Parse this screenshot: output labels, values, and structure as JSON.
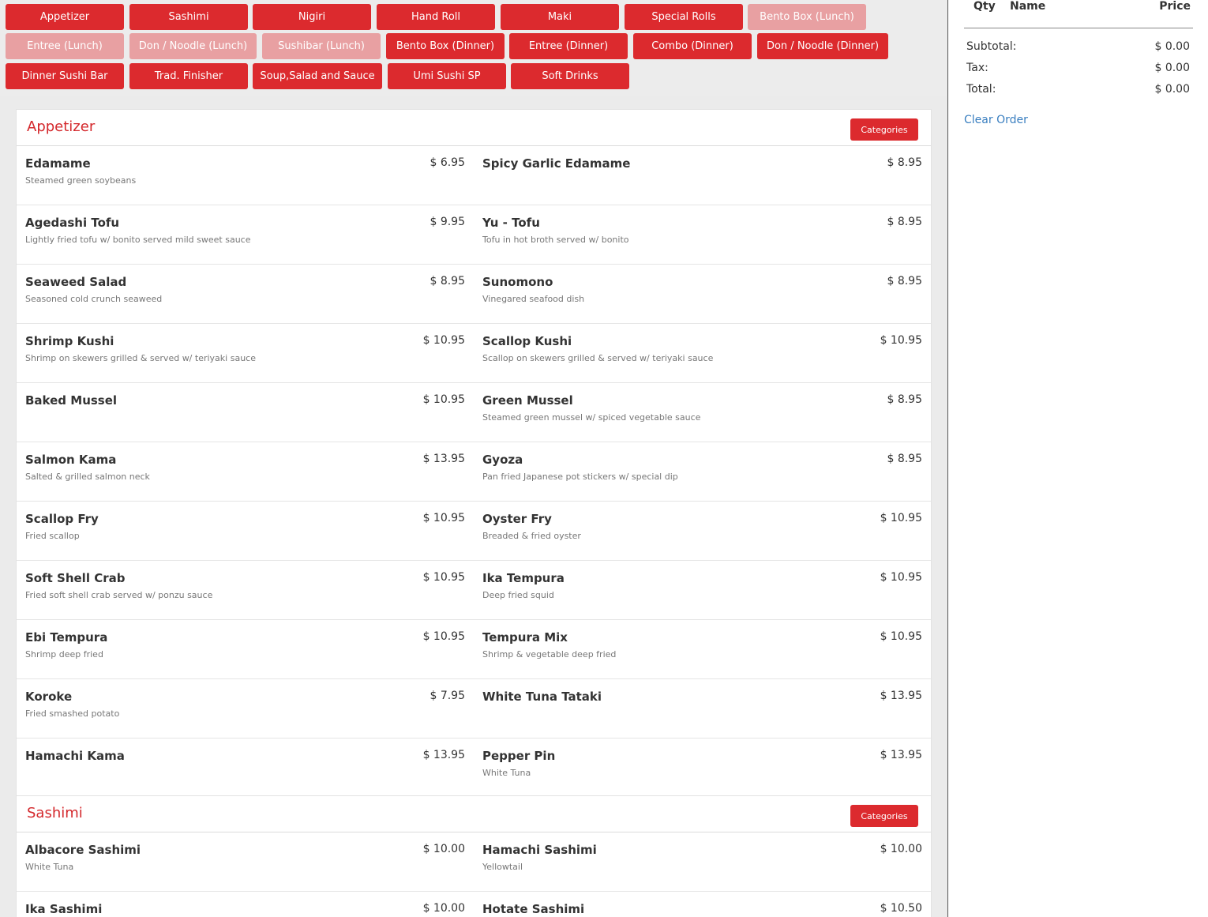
{
  "categories": [
    {
      "label": "Appetizer",
      "active": true
    },
    {
      "label": "Sashimi",
      "active": true
    },
    {
      "label": "Nigiri",
      "active": true
    },
    {
      "label": "Hand Roll",
      "active": true
    },
    {
      "label": "Maki",
      "active": true
    },
    {
      "label": "Special Rolls",
      "active": true
    },
    {
      "label": "Bento Box (Lunch)",
      "active": false
    },
    {
      "label": "Entree (Lunch)",
      "active": false
    },
    {
      "label": "Don / Noodle (Lunch)",
      "active": false
    },
    {
      "label": "Sushibar (Lunch)",
      "active": false
    },
    {
      "label": "Bento Box (Dinner)",
      "active": true
    },
    {
      "label": "Entree (Dinner)",
      "active": true
    },
    {
      "label": "Combo (Dinner)",
      "active": true
    },
    {
      "label": "Don / Noodle (Dinner)",
      "active": true
    },
    {
      "label": "Dinner Sushi Bar",
      "active": true
    },
    {
      "label": "Trad. Finisher",
      "active": true
    },
    {
      "label": "Soup,Salad and Sauce",
      "active": true
    },
    {
      "label": "Umi Sushi SP",
      "active": true
    },
    {
      "label": "Soft Drinks",
      "active": true
    }
  ],
  "colors": {
    "accent": "#dc2a2e",
    "disabled": "#e8a0a2",
    "link": "#3a7fc0"
  },
  "sections": [
    {
      "title": "Appetizer",
      "categories_button": "Categories",
      "items": [
        {
          "name": "Edamame",
          "price": "$ 6.95",
          "desc": "Steamed green soybeans"
        },
        {
          "name": "Spicy Garlic Edamame",
          "price": "$ 8.95",
          "desc": ""
        },
        {
          "name": "Agedashi Tofu",
          "price": "$ 9.95",
          "desc": "Lightly fried tofu w/ bonito served mild sweet sauce"
        },
        {
          "name": "Yu - Tofu",
          "price": "$ 8.95",
          "desc": "Tofu in hot broth served w/ bonito"
        },
        {
          "name": "Seaweed Salad",
          "price": "$ 8.95",
          "desc": "Seasoned cold crunch seaweed"
        },
        {
          "name": "Sunomono",
          "price": "$ 8.95",
          "desc": "Vinegared seafood dish"
        },
        {
          "name": "Shrimp Kushi",
          "price": "$ 10.95",
          "desc": "Shrimp on skewers grilled & served w/ teriyaki sauce"
        },
        {
          "name": "Scallop Kushi",
          "price": "$ 10.95",
          "desc": "Scallop on skewers grilled & served w/ teriyaki sauce"
        },
        {
          "name": "Baked Mussel",
          "price": "$ 10.95",
          "desc": ""
        },
        {
          "name": "Green Mussel",
          "price": "$ 8.95",
          "desc": "Steamed green mussel w/ spiced vegetable sauce"
        },
        {
          "name": "Salmon Kama",
          "price": "$ 13.95",
          "desc": "Salted & grilled salmon neck"
        },
        {
          "name": "Gyoza",
          "price": "$ 8.95",
          "desc": "Pan fried Japanese pot stickers w/ special dip"
        },
        {
          "name": "Scallop Fry",
          "price": "$ 10.95",
          "desc": "Fried scallop"
        },
        {
          "name": "Oyster Fry",
          "price": "$ 10.95",
          "desc": "Breaded & fried oyster"
        },
        {
          "name": "Soft Shell Crab",
          "price": "$ 10.95",
          "desc": "Fried soft shell crab served w/ ponzu sauce"
        },
        {
          "name": "Ika Tempura",
          "price": "$ 10.95",
          "desc": "Deep fried squid"
        },
        {
          "name": "Ebi Tempura",
          "price": "$ 10.95",
          "desc": "Shrimp deep fried"
        },
        {
          "name": "Tempura Mix",
          "price": "$ 10.95",
          "desc": "Shrimp & vegetable deep fried"
        },
        {
          "name": "Koroke",
          "price": "$ 7.95",
          "desc": "Fried smashed potato"
        },
        {
          "name": "White Tuna Tataki",
          "price": "$ 13.95",
          "desc": ""
        },
        {
          "name": "Hamachi Kama",
          "price": "$ 13.95",
          "desc": ""
        },
        {
          "name": "Pepper Pin",
          "price": "$ 13.95",
          "desc": "White Tuna"
        }
      ]
    },
    {
      "title": "Sashimi",
      "categories_button": "Categories",
      "items": [
        {
          "name": "Albacore Sashimi",
          "price": "$ 10.00",
          "desc": "White Tuna"
        },
        {
          "name": "Hamachi Sashimi",
          "price": "$ 10.00",
          "desc": "Yellowtail"
        },
        {
          "name": "Ika Sashimi",
          "price": "$ 10.00",
          "desc": ""
        },
        {
          "name": "Hotate Sashimi",
          "price": "$ 10.50",
          "desc": ""
        }
      ]
    }
  ],
  "order": {
    "headers": {
      "qty": "Qty",
      "name": "Name",
      "price": "Price"
    },
    "subtotal_label": "Subtotal:",
    "subtotal": "$ 0.00",
    "tax_label": "Tax:",
    "tax": "$ 0.00",
    "total_label": "Total:",
    "total": "$ 0.00",
    "clear_label": "Clear Order"
  }
}
